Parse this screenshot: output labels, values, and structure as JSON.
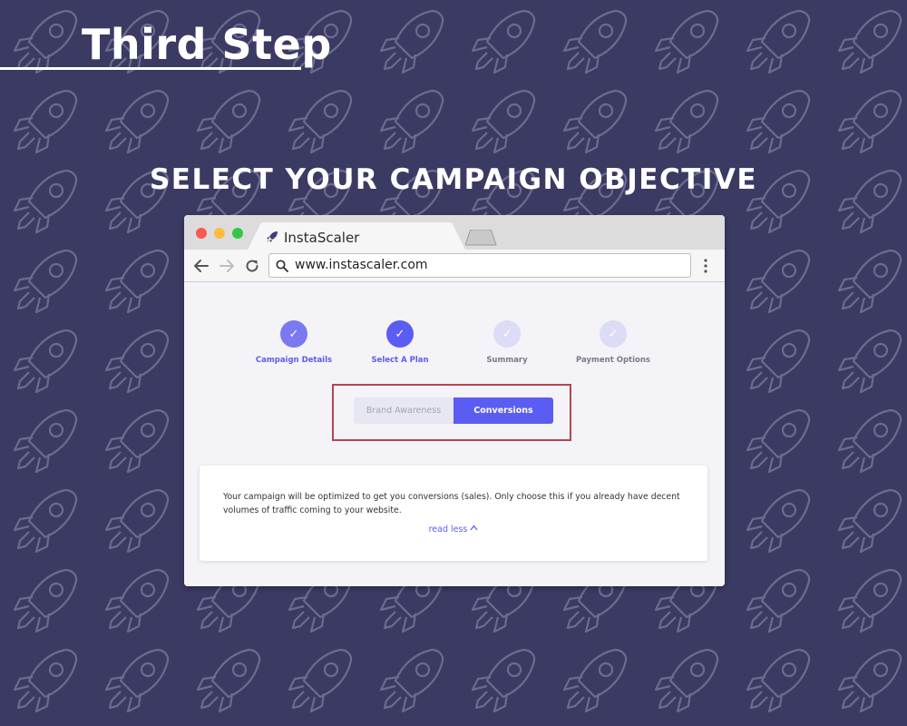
{
  "page": {
    "step_title": "Third Step",
    "headline": "SELECT YOUR CAMPAIGN OBJECTIVE",
    "background_color": "#3b3a63",
    "pattern_icon": "rocket-icon"
  },
  "browser": {
    "tab_title": "InstaScaler",
    "url": "www.instascaler.com",
    "icons": {
      "back": "arrow-left-icon",
      "forward": "arrow-right-icon",
      "reload": "reload-icon",
      "search": "search-icon",
      "menu": "kebab-menu-icon",
      "logo": "rocket-icon"
    }
  },
  "wizard": {
    "steps": [
      {
        "label": "Campaign Details",
        "state": "completed",
        "color": "#7b79f0"
      },
      {
        "label": "Select A Plan",
        "state": "current",
        "color": "#5b5cf2"
      },
      {
        "label": "Summary",
        "state": "pending",
        "color": "#dcdcf7"
      },
      {
        "label": "Payment Options",
        "state": "pending",
        "color": "#dcdcf7"
      }
    ],
    "check_mark": "✓"
  },
  "objective": {
    "options": [
      "Brand Awareness",
      "Conversions"
    ],
    "selected": "Conversions",
    "highlight_color": "#b8434f",
    "accent_color": "#5b5cf2"
  },
  "description": {
    "text": "Your campaign will be optimized to get you conversions (sales). Only choose this if you already have decent volumes of traffic coming to your website.",
    "link": "read less",
    "link_icon": "chevron-up-icon"
  }
}
